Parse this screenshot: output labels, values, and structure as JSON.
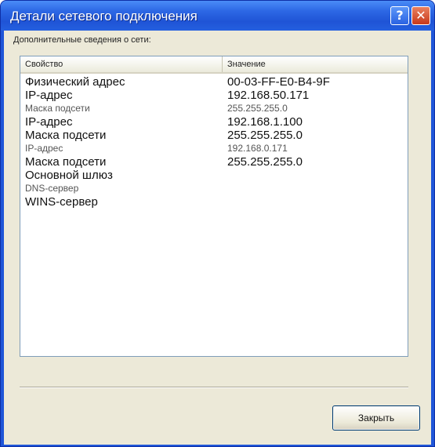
{
  "window": {
    "title": "Детали сетевого подключения",
    "help_glyph": "?",
    "close_glyph": "✕"
  },
  "caption": "Дополнительные сведения о сети:",
  "list": {
    "columns": [
      "Свойство",
      "Значение"
    ],
    "rows": [
      {
        "property": "Физический адрес",
        "value": "00-03-FF-E0-B4-9F"
      },
      {
        "property": "IP-адрес",
        "value": "192.168.50.171"
      },
      {
        "property": "Маска подсети",
        "value": "255.255.255.0"
      },
      {
        "property": "IP-адрес",
        "value": "192.168.1.100"
      },
      {
        "property": "Маска подсети",
        "value": "255.255.255.0"
      },
      {
        "property": "IP-адрес",
        "value": "192.168.0.171"
      },
      {
        "property": "Маска подсети",
        "value": "255.255.255.0"
      },
      {
        "property": "Основной шлюз",
        "value": ""
      },
      {
        "property": "DNS-сервер",
        "value": ""
      },
      {
        "property": "WINS-сервер",
        "value": ""
      }
    ]
  },
  "buttons": {
    "close_label": "Закрыть"
  }
}
